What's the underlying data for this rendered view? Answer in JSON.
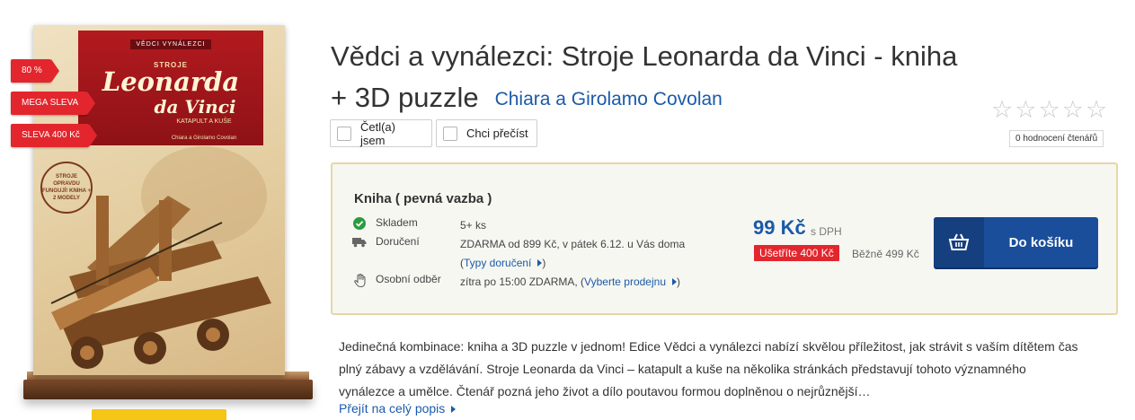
{
  "cover": {
    "series": "VĚDCI   VYNÁLEZCI",
    "line1": "STROJE",
    "line2": "Leonarda",
    "line3": "da Vinci",
    "line4": "KATAPULT A KUŠE",
    "line5": "Chiara a Girolamo Covolan",
    "stamp": "STROJE OPRAVDU FUNGUJÍ! KNIHA + 2 MODELY"
  },
  "badges": [
    "80 %",
    "MEGA SLEVA",
    "SLEVA 400 Kč"
  ],
  "product": {
    "title": "Vědci a vynálezci: Stroje Leonarda da Vinci - kniha + 3D puzzle",
    "author": "Chiara a Girolamo Covolan"
  },
  "rating": {
    "stars_filled": 0,
    "stars_total": 5,
    "count_label": "0 hodnocení čtenářů"
  },
  "checks": {
    "read": "Četl(a) jsem",
    "want": "Chci přečíst"
  },
  "buy": {
    "format": "Kniha ( pevná vazba )",
    "stock_label": "Skladem",
    "stock_value": "5+ ks",
    "delivery_label": "Doručení",
    "delivery_value": "ZDARMA od 899 Kč, v pátek 6.12. u Vás doma",
    "delivery_link": "Typy doručení",
    "pickup_label": "Osobní odběr",
    "pickup_value": "zítra po 15:00 ZDARMA, (",
    "pickup_link": "Vyberte prodejnu",
    "pickup_close": ")",
    "delivery_open": "(",
    "delivery_close": ")",
    "price": "99 Kč",
    "price_vat": "s DPH",
    "save": "Ušetříte 400 Kč",
    "regular": "Běžně 499 Kč",
    "cart_label": "Do košíku"
  },
  "description": {
    "text": "Jedinečná kombinace: kniha a 3D puzzle v jednom! Edice Vědci a vynálezci nabízí skvělou příležitost, jak strávit s vaším dítětem čas plný zábavy a vzdělávání. Stroje Leonarda da Vinci – katapult a kuše na několika stránkách představují tohoto významného vynálezce a umělce. Čtenář pozná jeho život a dílo poutavou formou doplněnou o nejrůznější…",
    "more": "Přejít na celý popis"
  },
  "colors": {
    "accent": "#1a5aa8",
    "badge": "#e3262d",
    "cart": "#1a4e9a"
  }
}
